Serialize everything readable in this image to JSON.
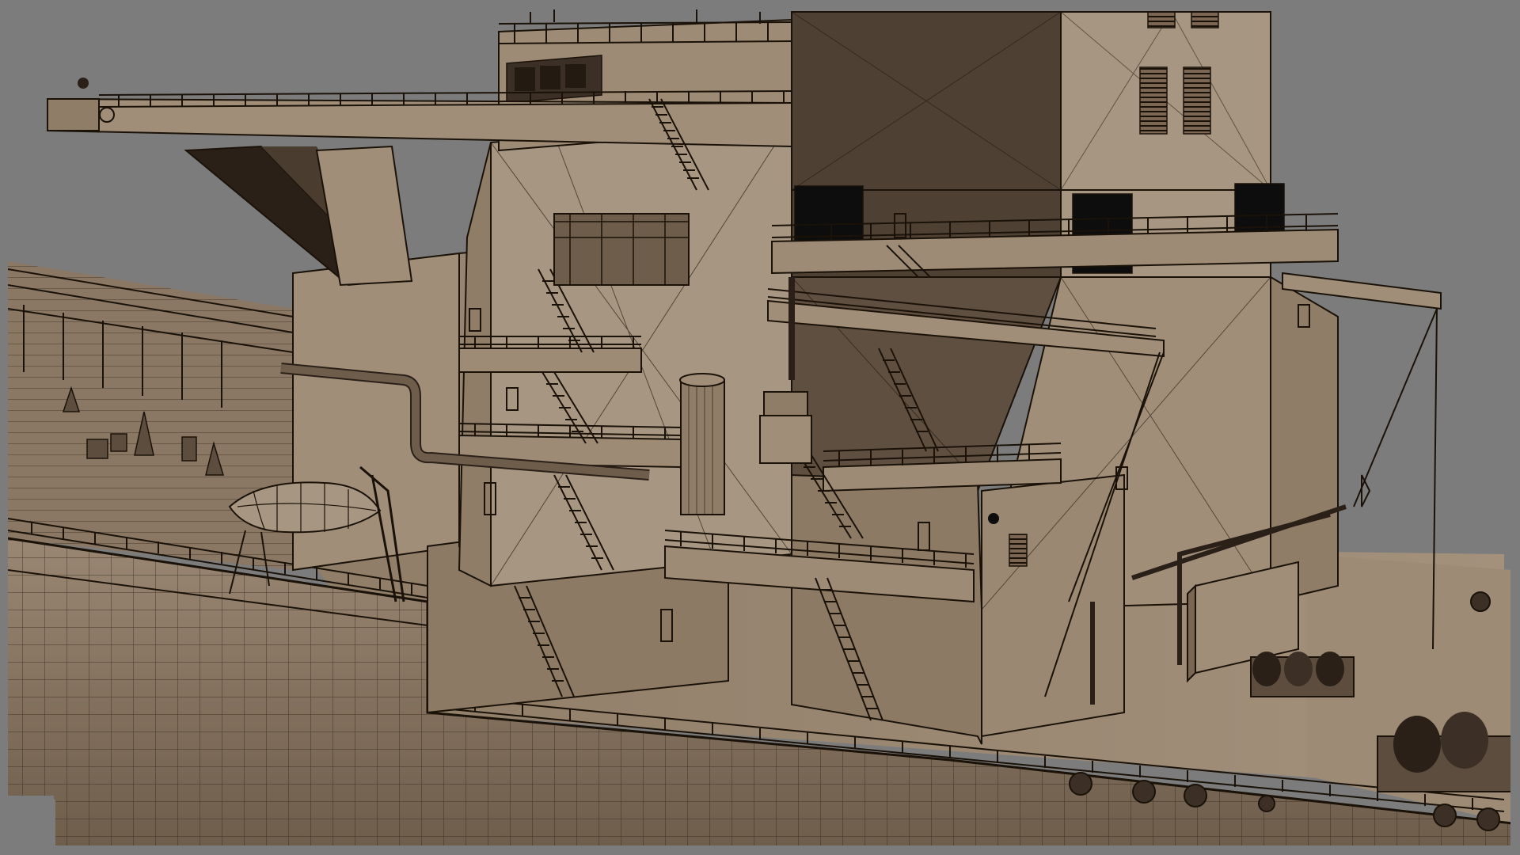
{
  "viewport": {
    "kind": "3d-wireframe-viewport",
    "background": "#7c7c7c",
    "line_color": "#1a1208"
  },
  "palette": {
    "hull_light": "#a3917c",
    "hull_mid": "#8e7c67",
    "hull_dark": "#5c4d3e",
    "super_light": "#a79681",
    "super_mid": "#8f7d68",
    "super_shadow": "#4e4134",
    "deck": "#9a8873",
    "window": "#0d0d0d"
  },
  "model": {
    "subject": "ship-aft-superstructure",
    "parts": [
      "bridge-wing",
      "funnel-casing",
      "accommodation-block",
      "lifeboat",
      "davit-crane",
      "stairs",
      "railings",
      "mooring-winches",
      "bollards",
      "pipes",
      "hull-plating"
    ]
  }
}
